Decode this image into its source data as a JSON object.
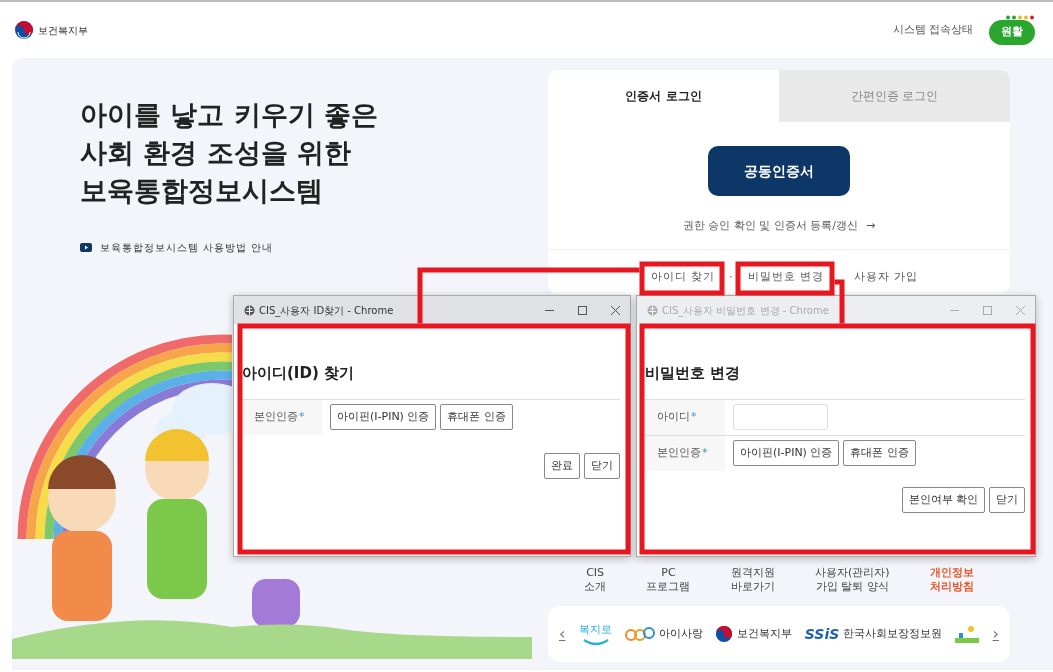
{
  "header": {
    "logo_text": "보건복지부",
    "status_label": "시스템 접속상태",
    "status_value": "원활"
  },
  "hero": {
    "title_lines": [
      "아이를 낳고 키우기 좋은",
      "사회 환경 조성을 위한",
      "보육통합정보시스템"
    ],
    "guide_link": "보육통합정보시스템 사용방법 안내"
  },
  "login": {
    "tabs": [
      {
        "label": "인증서 로그인",
        "selected": true
      },
      {
        "label": "간편인증 로그인",
        "selected": false
      }
    ],
    "primary_button": "공동인증서",
    "register_link": "권한 승인 확인 및 인증서 등록/갱신",
    "register_arrow": "→",
    "links": [
      {
        "label": "아이디 찾기",
        "separator": "·"
      },
      {
        "label": "비밀번호 변경"
      },
      {
        "label": "사용자 가입"
      }
    ]
  },
  "footer_menu": [
    {
      "label": "CIS\n소개",
      "emphasized": false
    },
    {
      "label": "PC\n프로그램",
      "emphasized": false
    },
    {
      "label": "원격지원\n바로가기",
      "emphasized": false
    },
    {
      "label": "사용자(관리자)\n가입 탈퇴 양식",
      "emphasized": false
    },
    {
      "label": "개인정보\n처리방침",
      "emphasized": true
    }
  ],
  "partners": {
    "prev": "‹",
    "next": "›",
    "items": [
      {
        "kind": "bokjiro",
        "label": "복지로"
      },
      {
        "kind": "aisarang",
        "label": "아이사랑"
      },
      {
        "kind": "mohw",
        "label": "보건복지부"
      },
      {
        "kind": "ssis",
        "label": "SSiS",
        "sublabel": "한국사회보장정보원"
      },
      {
        "kind": "partial"
      }
    ]
  },
  "windows": [
    {
      "title": "CIS_사용자 ID찾기 - Chrome",
      "active": true,
      "heading": "아이디(ID) 찾기",
      "rows": [
        {
          "kind": "buttons",
          "label": "본인인증",
          "required_mark": "*",
          "buttons": [
            "아이핀(I-PIN) 인증",
            "휴대폰 인증"
          ]
        }
      ],
      "actions": [
        "완료",
        "닫기"
      ]
    },
    {
      "title": "CIS_사용자 비밀번호 변경 - Chrome",
      "active": false,
      "heading": "비밀번호 변경",
      "rows": [
        {
          "kind": "input",
          "label": "아이디",
          "required_mark": "*"
        },
        {
          "kind": "buttons",
          "label": "본인인증",
          "required_mark": "*",
          "buttons": [
            "아이핀(I-PIN) 인증",
            "휴대폰 인증"
          ]
        }
      ],
      "actions": [
        "본인여부 확인",
        "닫기"
      ]
    }
  ]
}
